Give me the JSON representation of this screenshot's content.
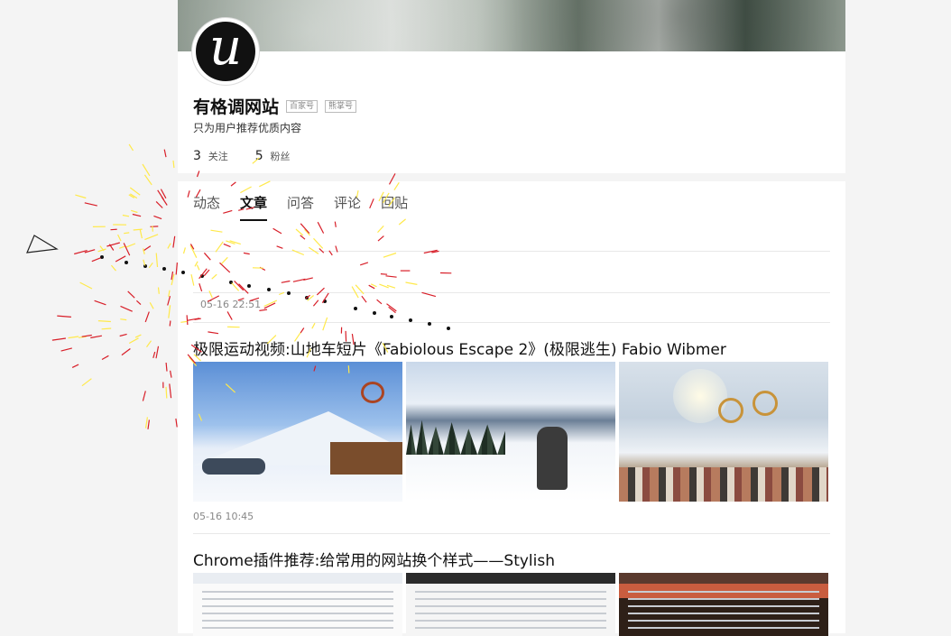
{
  "profile": {
    "name": "有格调网站",
    "avatar_letter": "u",
    "tags": [
      "百家号",
      "熊掌号"
    ],
    "tagline": "只为用户推荐优质内容",
    "stats": [
      {
        "num": "3",
        "label": "关注"
      },
      {
        "num": "5",
        "label": "粉丝"
      }
    ]
  },
  "tabs": [
    {
      "label": "动态",
      "active": false
    },
    {
      "label": "文章",
      "active": true
    },
    {
      "label": "问答",
      "active": false
    },
    {
      "label": "评论",
      "active": false
    },
    {
      "label": "回贴",
      "active": false
    }
  ],
  "feed": [
    {
      "time": "05-16 22:51"
    },
    {
      "title": "极限运动视频:山地车短片《Fabiolous Escape 2》(极限逃生) Fabio Wibmer",
      "time": "05-16 10:45"
    },
    {
      "title": "Chrome插件推荐:给常用的网站换个样式——Stylish"
    }
  ],
  "colors": {
    "background": "#f4f4f4",
    "card": "#ffffff",
    "firework_red": "#d81e28",
    "firework_yellow": "#ffe94a"
  }
}
